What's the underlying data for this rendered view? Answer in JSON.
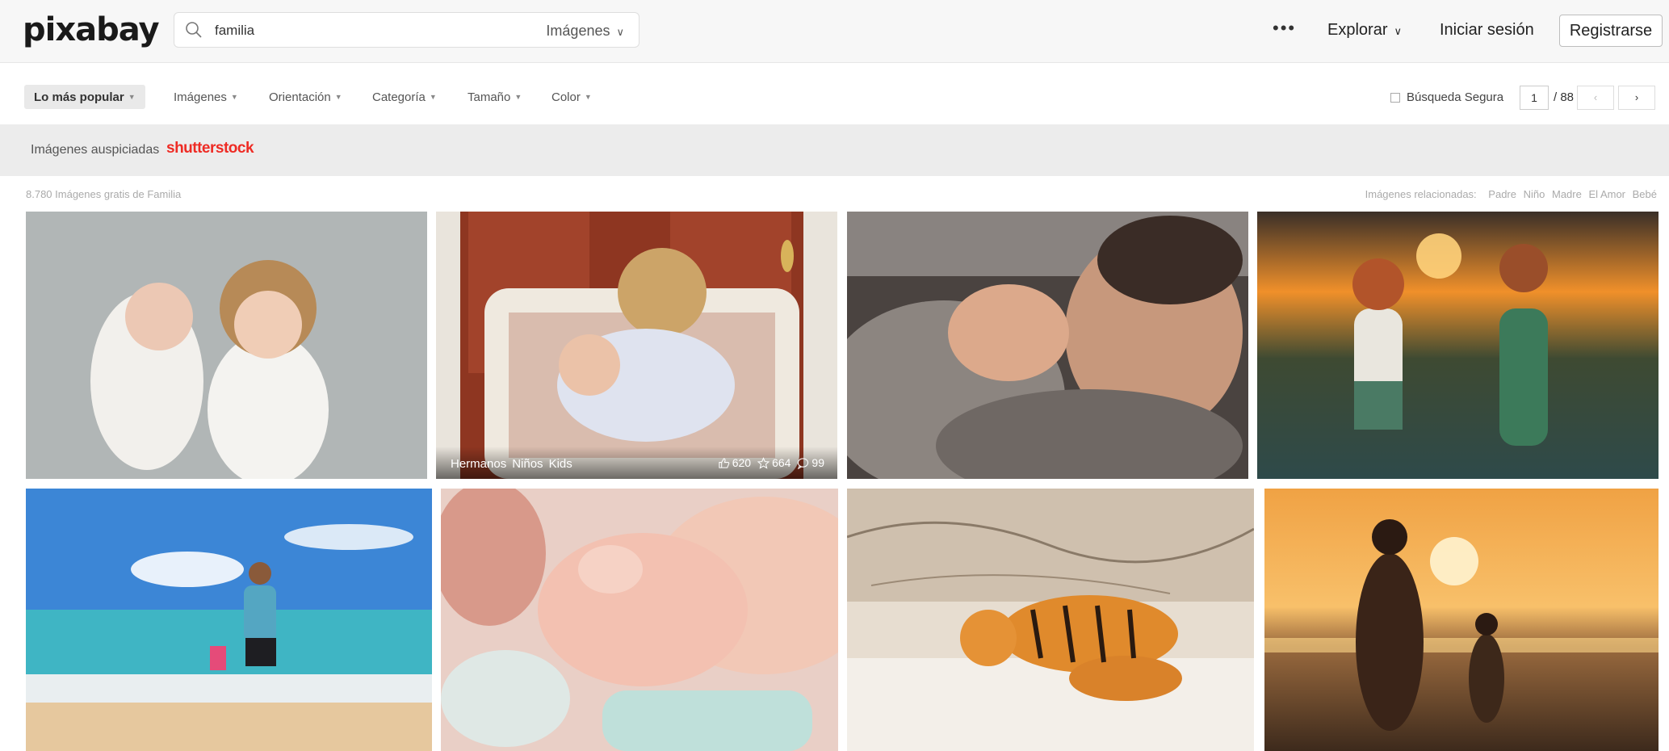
{
  "header": {
    "logo": "pixabay",
    "search": {
      "value": "familia",
      "type_label": "Imágenes"
    },
    "more_label": "•••",
    "explore_label": "Explorar",
    "login_label": "Iniciar sesión",
    "register_label": "Registrarse"
  },
  "filters": {
    "popular": "Lo más popular",
    "items": [
      "Imágenes",
      "Orientación",
      "Categoría",
      "Tamaño",
      "Color"
    ],
    "safe_search_label": "Búsqueda Segura",
    "safe_search_checked": false,
    "page": {
      "current": "1",
      "total": "/ 88"
    }
  },
  "sponsored": {
    "label": "Imágenes auspiciadas",
    "brand": "shutterstock"
  },
  "results": {
    "count_text": "8.780 Imágenes gratis de Familia",
    "related_label": "Imágenes relacionadas:",
    "related": [
      "Padre",
      "Niño",
      "Madre",
      "El Amor",
      "Bebé"
    ]
  },
  "photos": [
    {
      "subject": "two children lying on a blanket"
    },
    {
      "subject": "child hugging a baby on a white bench",
      "tags": [
        "Hermanos",
        "Niños",
        "Kids"
      ],
      "likes": "620",
      "favorites": "664",
      "comments": "99"
    },
    {
      "subject": "father sleeping with a newborn"
    },
    {
      "subject": "two children holding hands at sunset"
    },
    {
      "subject": "father and child walking on a beach"
    },
    {
      "subject": "baby hand holding a finger"
    },
    {
      "subject": "tigress and cub in the snow"
    },
    {
      "subject": "mother and child silhouette at sunset"
    }
  ],
  "colors": {
    "accent": "#ee2b24",
    "header_bg": "#f7f7f7",
    "sponsored_bg": "#ececec"
  }
}
